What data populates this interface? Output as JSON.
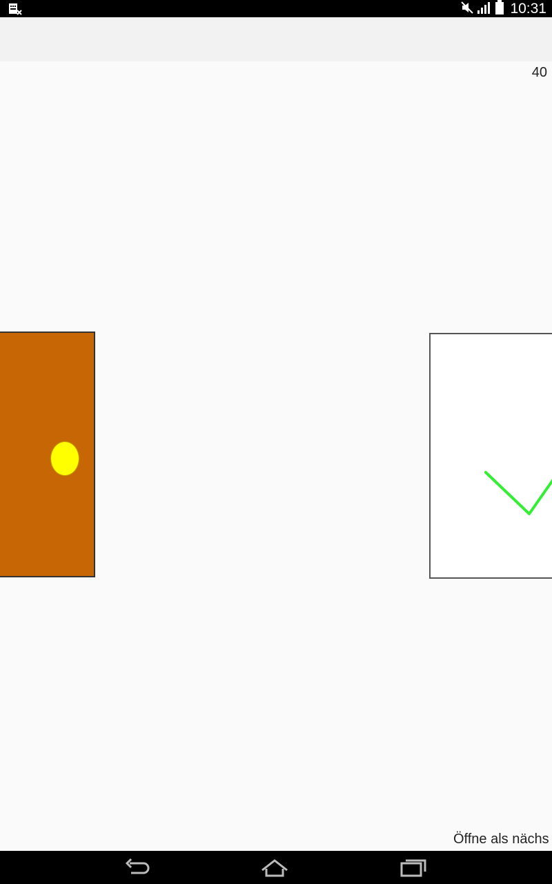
{
  "status_bar": {
    "time": "10:31",
    "icons": [
      "sim-card-icon",
      "mute-icon",
      "signal-icon",
      "battery-icon"
    ]
  },
  "content": {
    "counter": "40",
    "door": {
      "color": "#c66604",
      "knob_color": "#ffff00"
    },
    "check_card": {
      "check_color": "#33ee33"
    },
    "bottom_text": "Öffne als nächs"
  },
  "nav_bar": {
    "buttons": [
      "back-icon",
      "home-icon",
      "recent-apps-icon"
    ]
  }
}
